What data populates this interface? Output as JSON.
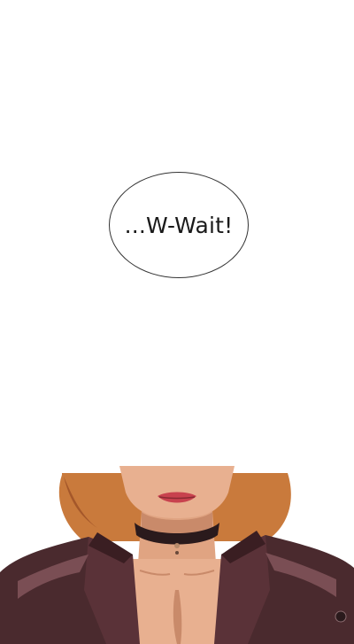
{
  "speech_bubble": {
    "text": "...W-Wait!"
  },
  "panel": {
    "illustration": "character-bust-with-choker-and-leather-jacket",
    "colors": {
      "skin": "#e8b090",
      "skin_shadow": "#c98a6a",
      "hair": "#c97a3c",
      "hair_dark": "#a4572a",
      "jacket": "#4a2a2e",
      "jacket_highlight": "#7a4e54",
      "choker": "#2a1a1c",
      "lips": "#c8424e"
    }
  }
}
